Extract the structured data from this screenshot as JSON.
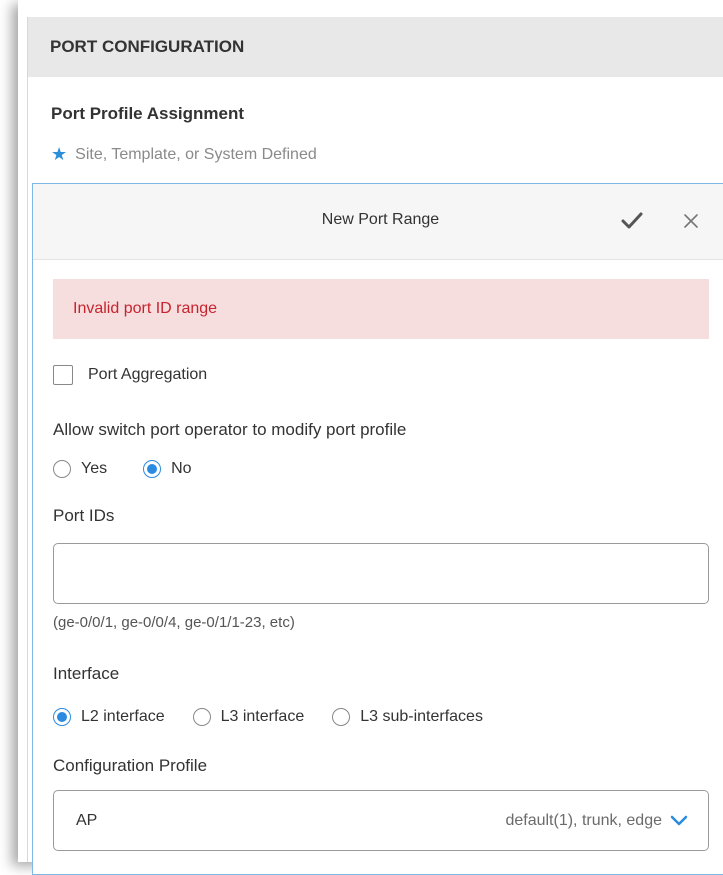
{
  "panel": {
    "header": "PORT CONFIGURATION",
    "section_title": "Port Profile Assignment",
    "section_sub": "Site, Template, or System Defined"
  },
  "modal": {
    "title": "New Port Range",
    "error": "Invalid port ID range",
    "aggregation_label": "Port Aggregation",
    "allow_label": "Allow switch port operator to modify port profile",
    "allow_options": [
      {
        "label": "Yes",
        "selected": false
      },
      {
        "label": "No",
        "selected": true
      }
    ],
    "port_ids_label": "Port IDs",
    "port_ids_value": "",
    "port_ids_hint": "(ge-0/0/1, ge-0/0/4, ge-0/1/1-23, etc)",
    "interface_label": "Interface",
    "interface_options": [
      {
        "label": "L2 interface",
        "selected": true
      },
      {
        "label": "L3 interface",
        "selected": false
      },
      {
        "label": "L3 sub-interfaces",
        "selected": false
      }
    ],
    "config_profile_label": "Configuration Profile",
    "config_profile_value": "AP",
    "config_profile_desc": "default(1), trunk, edge"
  },
  "colors": {
    "accent": "#2b8be0",
    "error_bg": "#f6dede",
    "error_text": "#c7232f"
  }
}
